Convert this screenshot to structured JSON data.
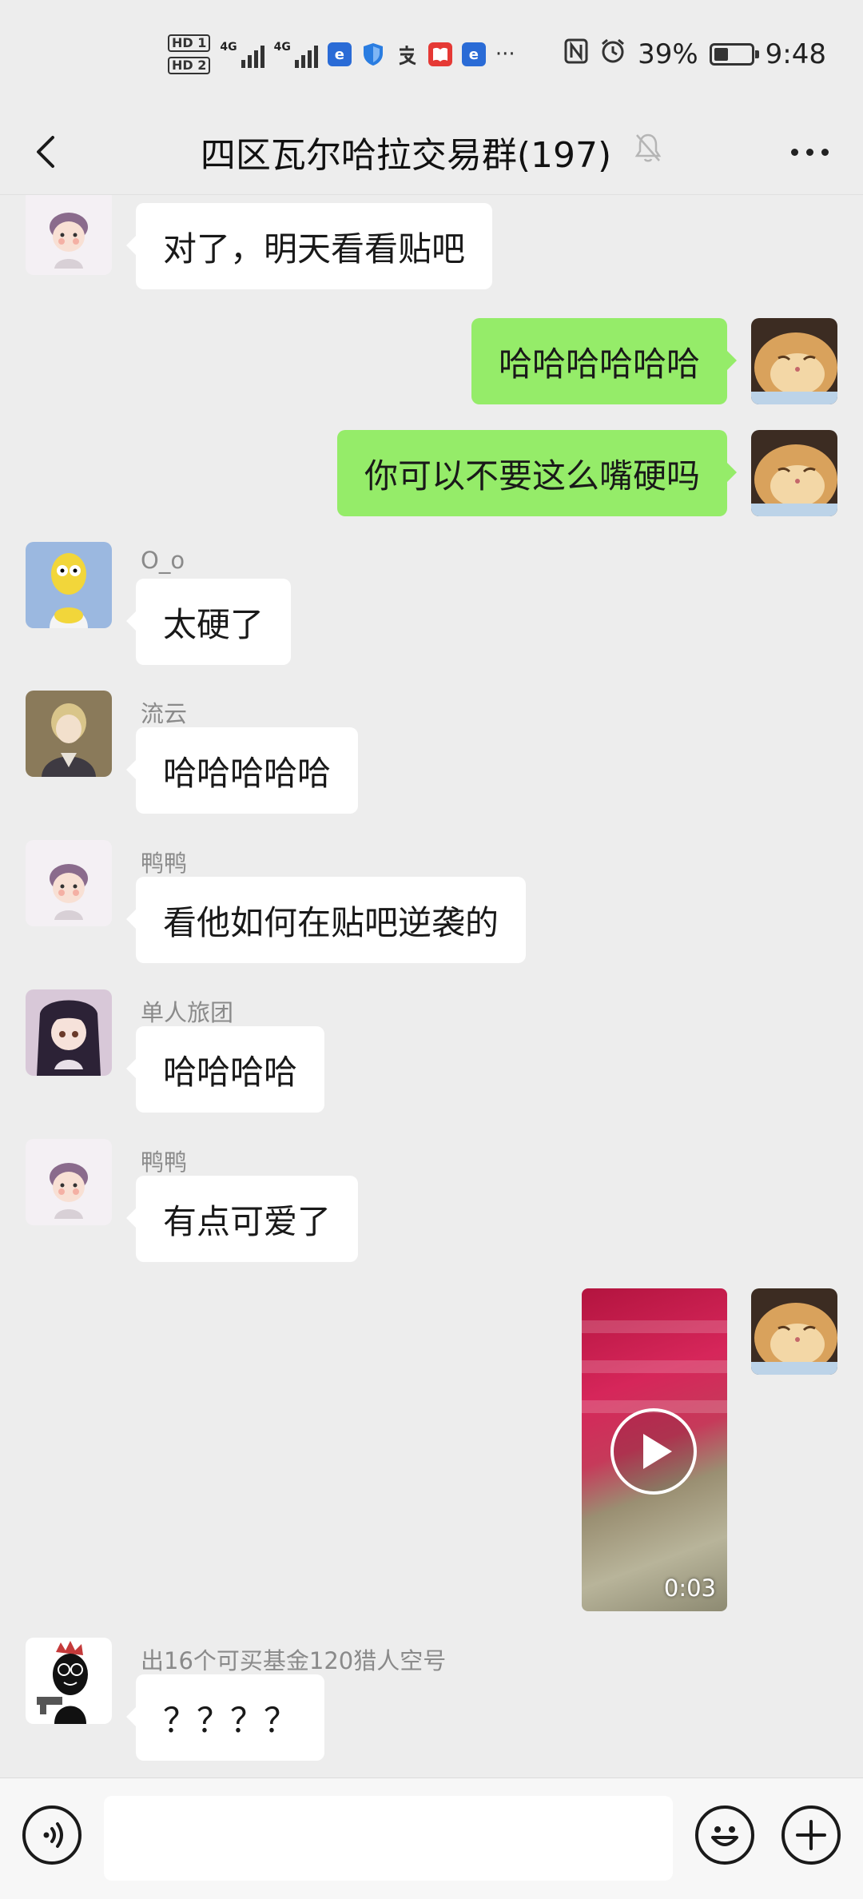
{
  "status_bar": {
    "hd1": "HD 1",
    "hd2": "HD 2",
    "net1": "4G",
    "net2": "4G",
    "more": "···",
    "battery_percent": "39%",
    "battery_level": 0.39,
    "time": "9:48"
  },
  "header": {
    "title": "四区瓦尔哈拉交易群(197)",
    "muted": true
  },
  "messages": [
    {
      "side": "left",
      "sender": "鸭鸭",
      "text": "对了，明天看看贴吧",
      "avatar": "boy-avatar"
    },
    {
      "side": "right",
      "text": "哈哈哈哈哈哈",
      "avatar": "cat-avatar"
    },
    {
      "side": "right",
      "text": "你可以不要这么嘴硬吗",
      "avatar": "cat-avatar"
    },
    {
      "side": "left",
      "sender": "O_o",
      "text": "太硬了",
      "avatar": "cartoon-avatar"
    },
    {
      "side": "left",
      "sender": "流云",
      "text": "哈哈哈哈哈",
      "avatar": "anime-man-avatar"
    },
    {
      "side": "left",
      "sender": "鸭鸭",
      "text": "看他如何在贴吧逆袭的",
      "avatar": "boy-avatar"
    },
    {
      "side": "left",
      "sender": "单人旅团",
      "text": "哈哈哈哈",
      "avatar": "anime-girl-avatar"
    },
    {
      "side": "left",
      "sender": "鸭鸭",
      "text": "有点可爱了",
      "avatar": "boy-avatar"
    },
    {
      "side": "right",
      "type": "video",
      "duration": "0:03",
      "avatar": "cat-avatar"
    },
    {
      "side": "left",
      "sender": "出16个可买基金120猎人空号",
      "text": "？？？？",
      "avatar": "gun-avatar"
    }
  ],
  "input_bar": {
    "placeholder": "",
    "icons": [
      "voice-icon",
      "emoji-icon",
      "plus-icon"
    ]
  },
  "colors": {
    "background": "#ededed",
    "my_bubble": "#95ec69",
    "their_bubble": "#ffffff"
  }
}
